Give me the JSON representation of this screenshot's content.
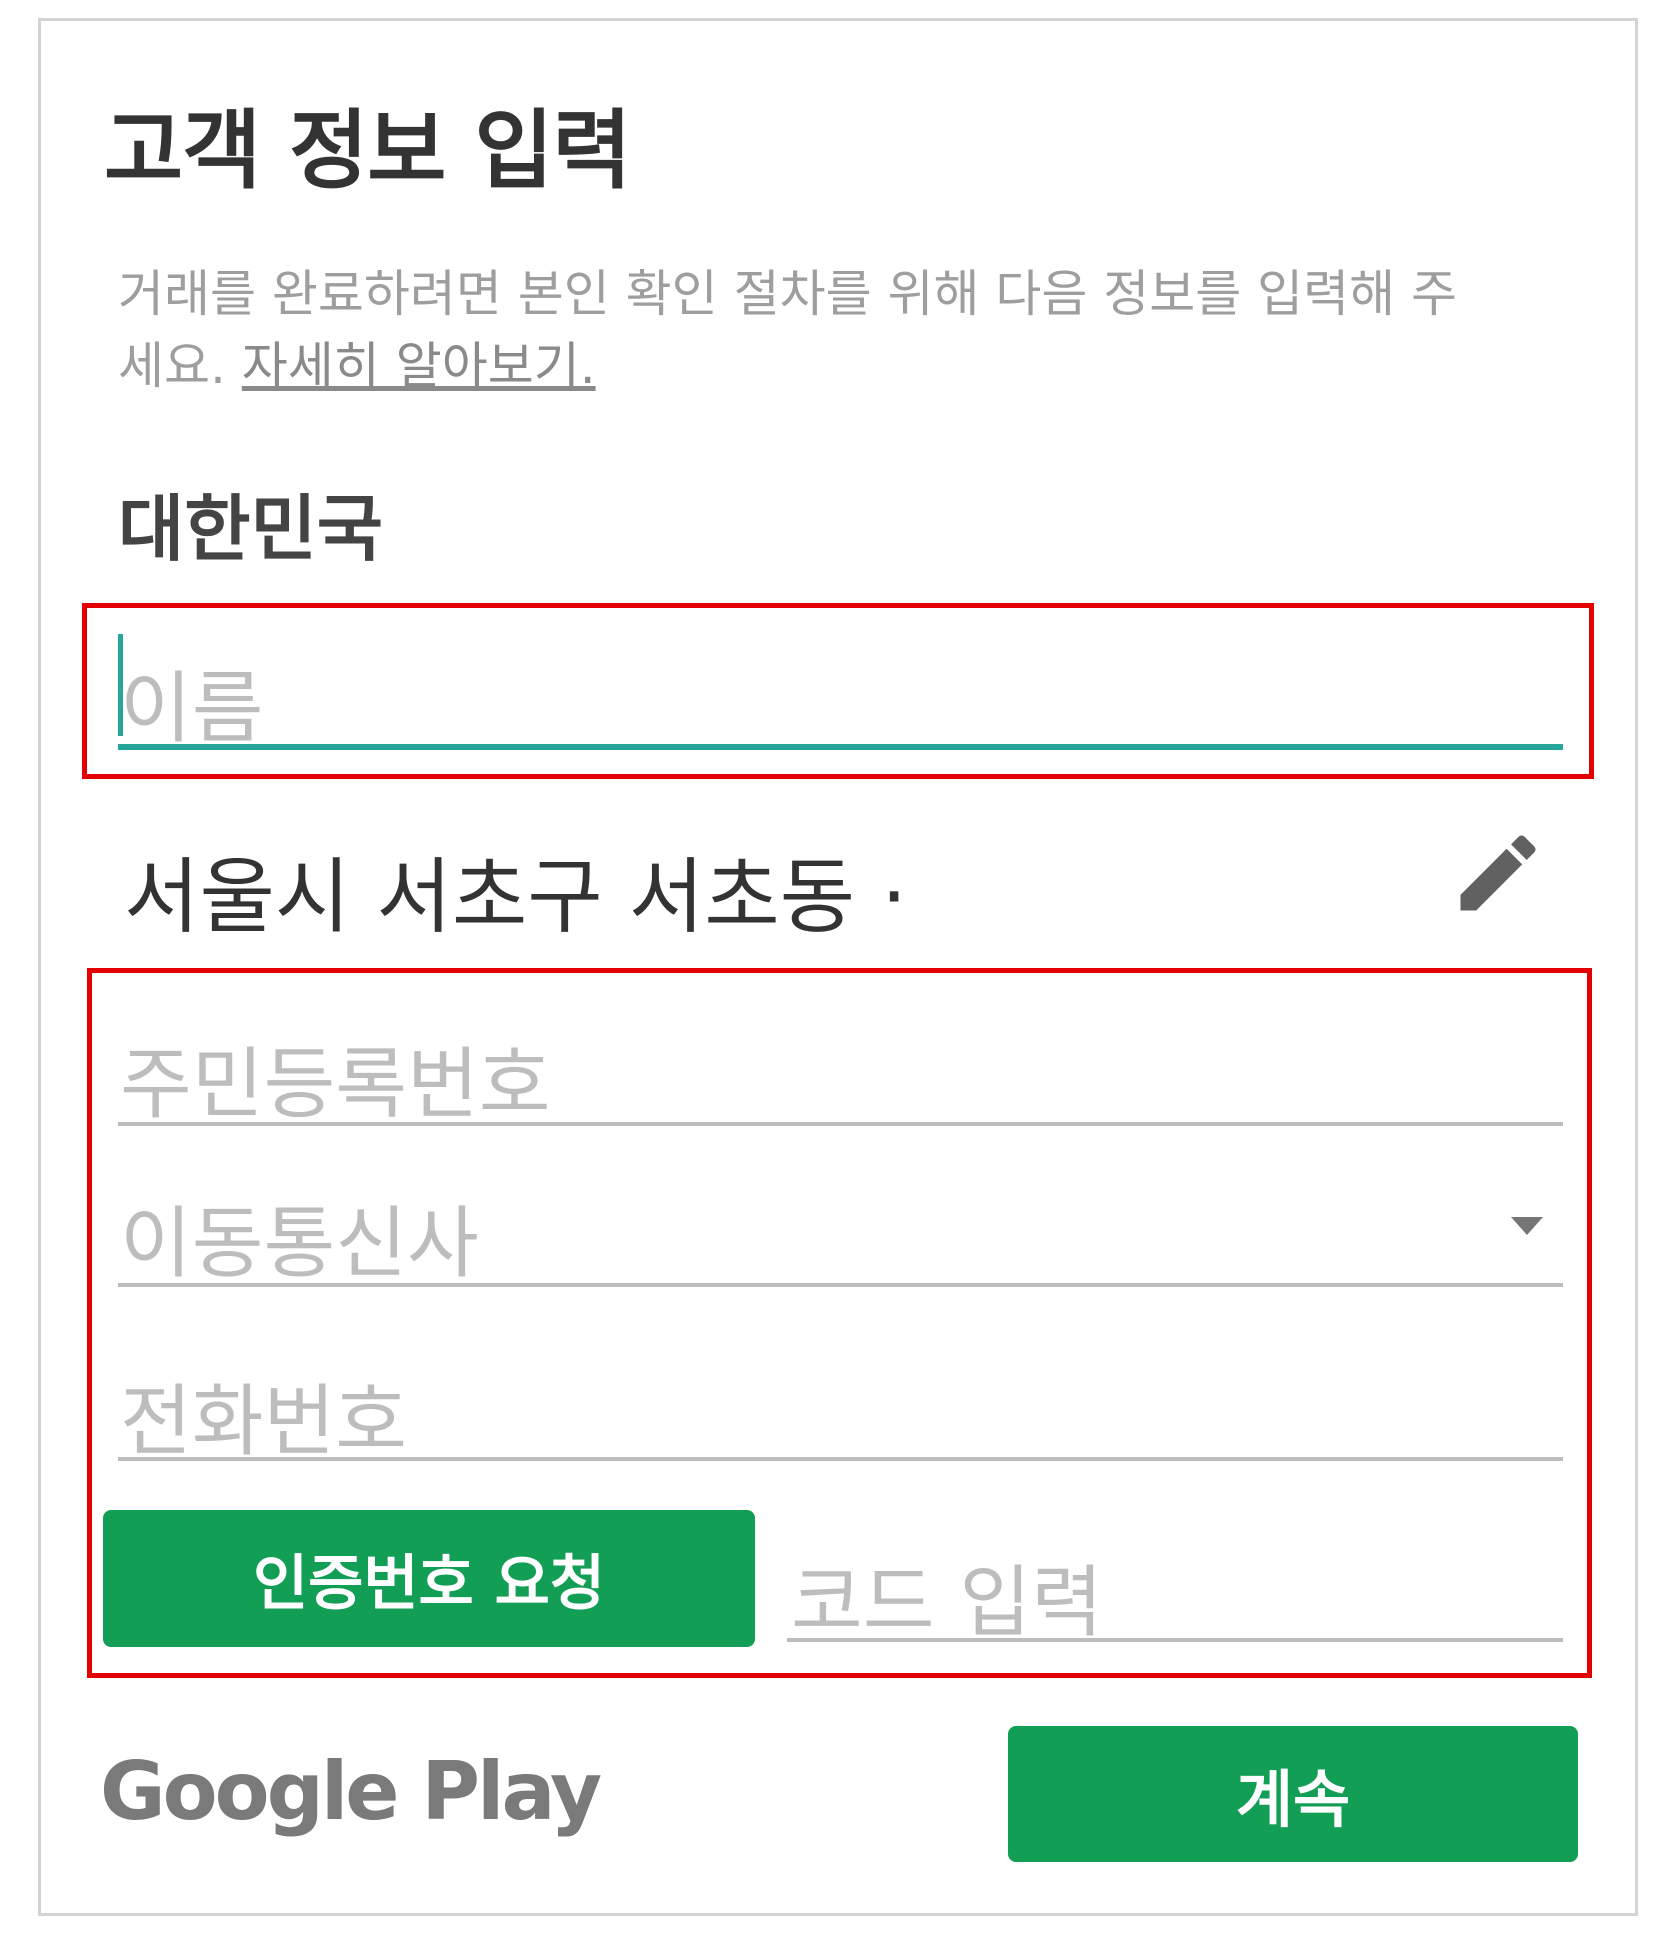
{
  "dialog": {
    "title": "고객 정보 입력",
    "description": "거래를 완료하려면 본인 확인 절차를 위해 다음 정보를 입력해 주세요. ",
    "learn_more_link": "자세히 알아보기."
  },
  "country": "대한민국",
  "fields": {
    "name_placeholder": "이름",
    "address": "서울시 서초구 서초동 ·",
    "ssn_placeholder": "주민등록번호",
    "carrier_placeholder": "이동통신사",
    "phone_placeholder": "전화번호",
    "code_placeholder": "코드 입력"
  },
  "buttons": {
    "verify": "인증번호 요청",
    "continue": "계속"
  },
  "brand": "Google Play",
  "colors": {
    "accent_green": "#139e56",
    "focus_teal": "#26a69a",
    "highlight_red": "#e30000"
  }
}
